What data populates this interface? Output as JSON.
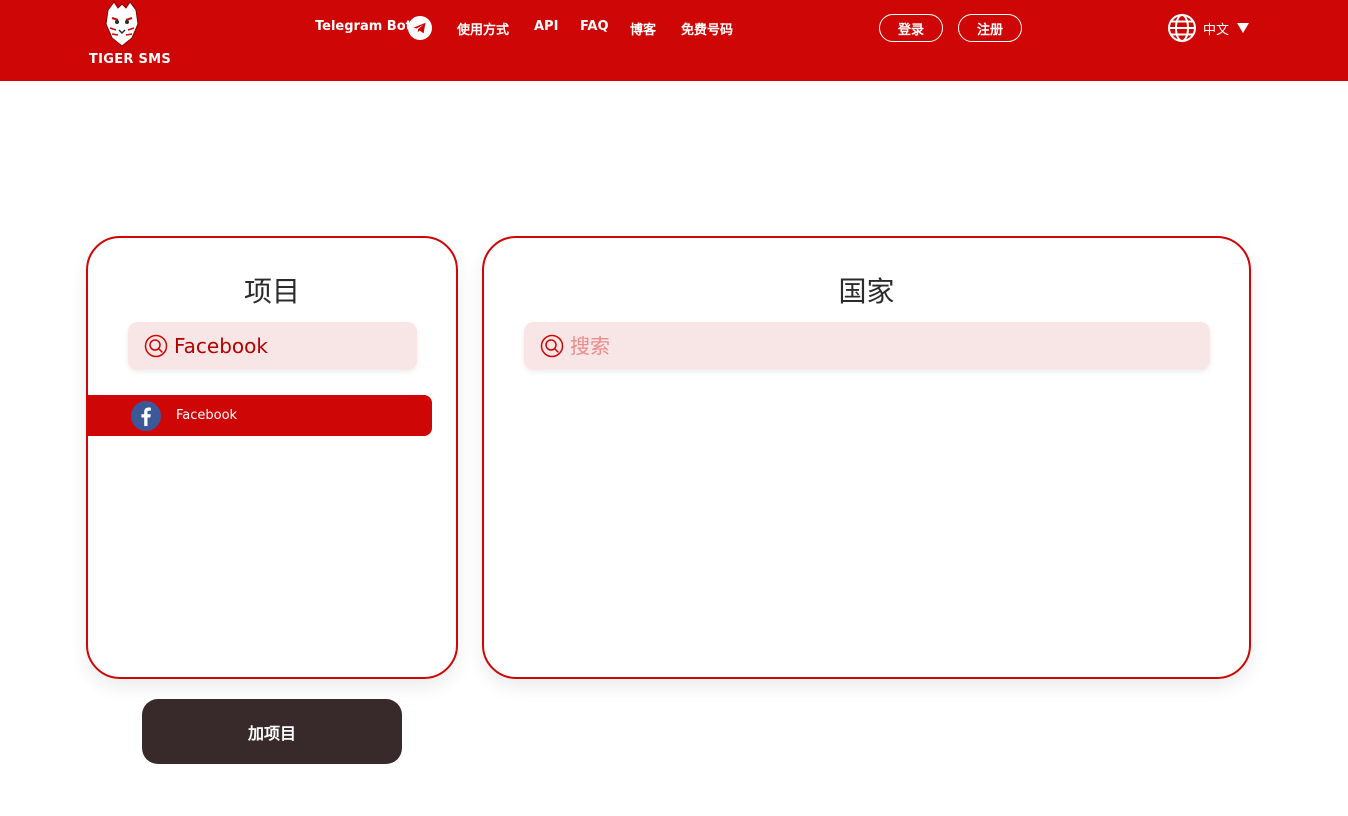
{
  "brand": {
    "name": "TIGER SMS"
  },
  "nav": {
    "telegram_bot": "Telegram Bot",
    "how_to_use": "使用方式",
    "api": "API",
    "faq": "FAQ",
    "blog": "博客",
    "free_numbers": "免费号码"
  },
  "auth": {
    "login": "登录",
    "register": "注册"
  },
  "language": {
    "current": "中文"
  },
  "services_panel": {
    "title": "项目",
    "search_value": "Facebook",
    "items": [
      {
        "name": "Facebook",
        "icon": "facebook-icon"
      }
    ]
  },
  "countries_panel": {
    "title": "国家",
    "search_placeholder": "搜索"
  },
  "add_service_button": "加项目",
  "colors": {
    "brand_red": "#cf0606",
    "search_bg": "#f8e5e5",
    "dark_button": "#382a2a",
    "facebook_blue": "#3b5998"
  }
}
